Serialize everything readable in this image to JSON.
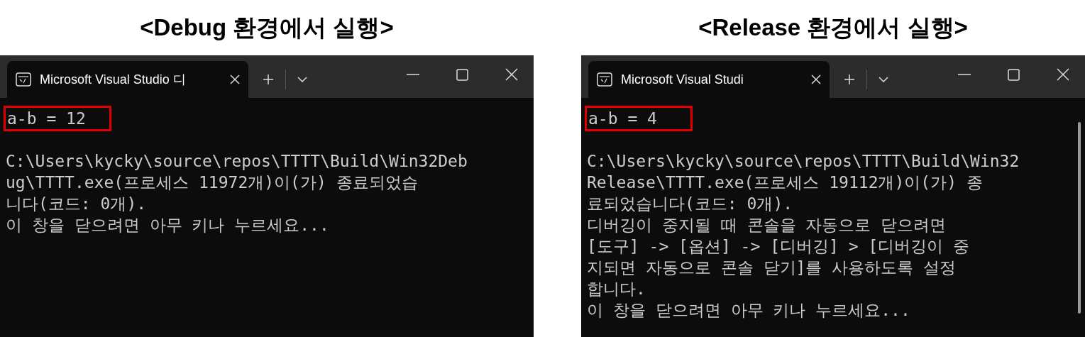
{
  "panels": [
    {
      "heading": "<Debug 환경에서 실행>",
      "window": {
        "tab_title": "Microsoft Visual Studio 디",
        "scrollbar": false,
        "result": {
          "text": "a-b = 12",
          "highlighted": true
        },
        "lines": [
          "C:\\Users\\kycky\\source\\repos\\TTTT\\Build\\Win32Deb",
          "ug\\TTTT.exe(프로세스 11972개)이(가) 종료되었습",
          "니다(코드: 0개).",
          "이 창을 닫으려면 아무 키나 누르세요..."
        ]
      }
    },
    {
      "heading": "<Release 환경에서 실행>",
      "window": {
        "tab_title": "Microsoft Visual Studi",
        "scrollbar": true,
        "result": {
          "text": "a-b = 4",
          "highlighted": true
        },
        "lines": [
          "C:\\Users\\kycky\\source\\repos\\TTTT\\Build\\Win32",
          "Release\\TTTT.exe(프로세스 19112개)이(가) 종",
          "료되었습니다(코드: 0개).",
          "디버깅이 중지될 때 콘솔을 자동으로 닫으려면",
          "[도구] -> [옵션] -> [디버깅] > [디버깅이 중",
          "지되면 자동으로 콘솔 닫기]를 사용하도록 설정",
          "합니다.",
          "이 창을 닫으려면 아무 키나 누르세요..."
        ]
      }
    }
  ]
}
